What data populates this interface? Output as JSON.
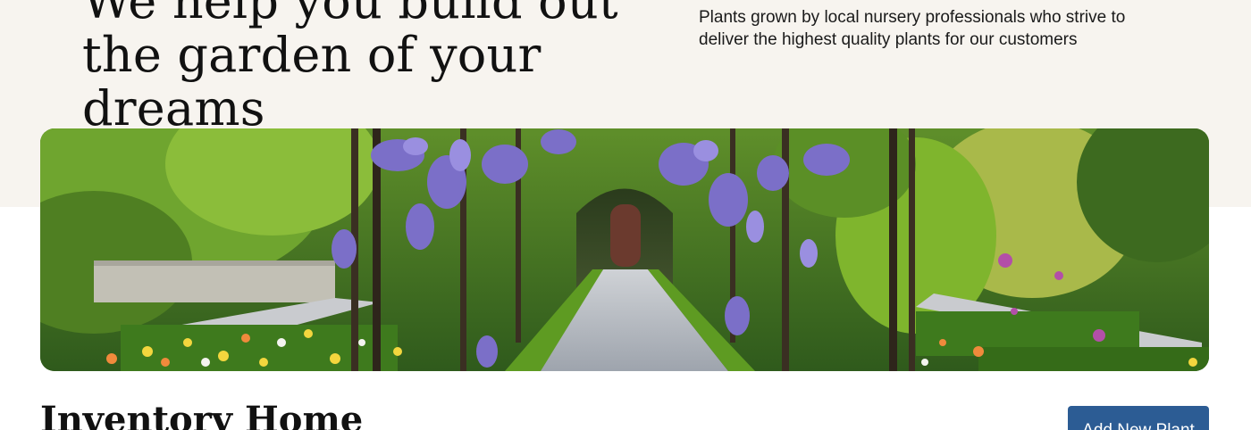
{
  "hero": {
    "title": "We help you build out the garden of your dreams",
    "tagline": "Plants grown by local nursery professionals who strive to deliver the highest quality plants for our customers"
  },
  "banner": {
    "image_subject": "garden-pergola-wisteria-photo"
  },
  "inventory": {
    "title": "Inventory Home",
    "add_button_label": "Add New Plant"
  },
  "colors": {
    "hero_background": "#f7f4ef",
    "button_primary": "#2c5c94",
    "text": "#111111"
  }
}
